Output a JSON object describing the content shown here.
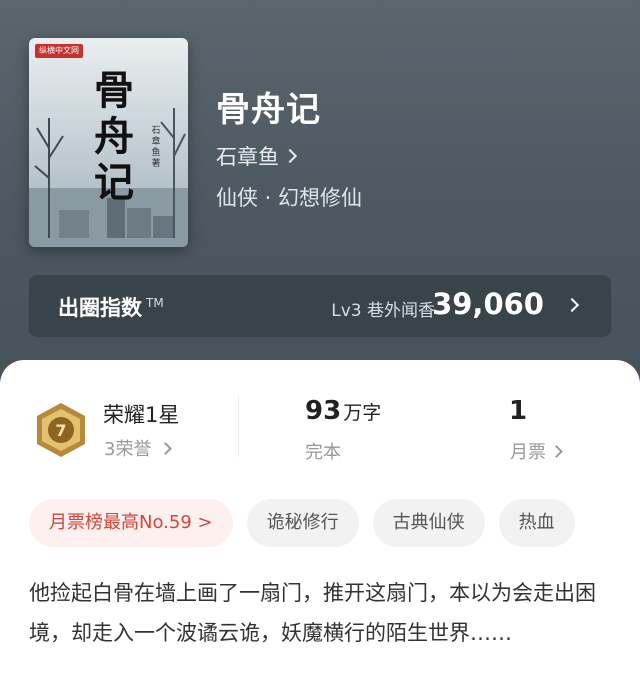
{
  "book": {
    "title": "骨舟记",
    "author": "石章鱼",
    "genre": "仙侠 · 幻想修仙",
    "cover": {
      "publisher": "纵横中文网",
      "title": "骨舟记",
      "author": "石章鱼 著"
    }
  },
  "circle_index": {
    "label": "出圈指数",
    "tm": "TM",
    "level": "Lv3 巷外闻香",
    "score": "39,060"
  },
  "stats": {
    "honor": {
      "title": "荣耀1星",
      "sub": "3荣誉",
      "badge_number": "7"
    },
    "words": {
      "value": "93",
      "unit": "万字",
      "sub": "完本"
    },
    "tickets": {
      "value": "1",
      "sub": "月票"
    }
  },
  "tags": [
    "月票榜最高No.59 >",
    "诡秘修行",
    "古典仙侠",
    "热血"
  ],
  "synopsis": "他捡起白骨在墙上画了一扇门，推开这扇门，本以为会走出困境，却走入一个波谲云诡，妖魔横行的陌生世界……",
  "colors": {
    "accent": "#d6453c",
    "hero_bg": "#4e5a62",
    "gold": "#c9a24a"
  }
}
